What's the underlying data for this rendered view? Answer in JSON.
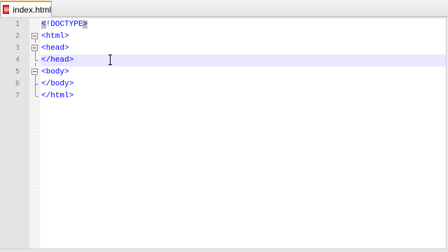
{
  "tabs": [
    {
      "label": "index.html",
      "icon": "html-file-icon",
      "active": true
    }
  ],
  "editor": {
    "current_line": 4,
    "lines": [
      {
        "number": "1",
        "text_selected": "<!DOCTYPE>",
        "text_selected_prefix": "<",
        "text_selected_body": "!DOCTYPE",
        "text_selected_suffix": ">"
      },
      {
        "number": "2",
        "text": "<html>"
      },
      {
        "number": "3",
        "text": "<head>"
      },
      {
        "number": "4",
        "text": "</head>"
      },
      {
        "number": "5",
        "text": "<body>"
      },
      {
        "number": "6",
        "text": "</body>"
      },
      {
        "number": "7",
        "text": "</html>"
      }
    ]
  },
  "colors": {
    "tag_text": "#0000ff",
    "line_number": "#808080",
    "current_line_highlight": "#e8e8ff",
    "selection": "#c0c0c0",
    "tab_accent": "#f49a1f"
  }
}
